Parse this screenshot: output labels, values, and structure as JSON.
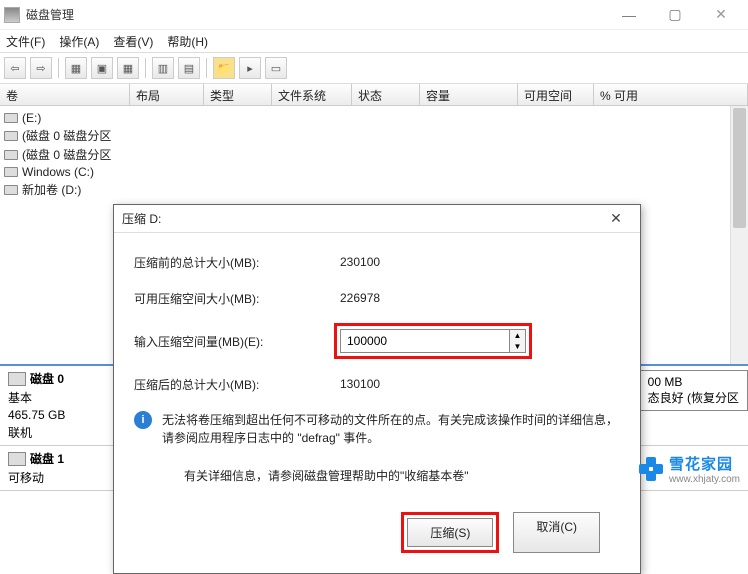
{
  "titlebar": {
    "title": "磁盘管理"
  },
  "menu": {
    "file": "文件(F)",
    "action": "操作(A)",
    "view": "查看(V)",
    "help": "帮助(H)"
  },
  "headers": {
    "volume": "卷",
    "layout": "布局",
    "type": "类型",
    "filesystem": "文件系统",
    "status": "状态",
    "capacity": "容量",
    "free": "可用空间",
    "percent": "% 可用"
  },
  "tree": {
    "items": [
      {
        "label": "(E:)"
      },
      {
        "label": "(磁盘 0 磁盘分区"
      },
      {
        "label": "(磁盘 0 磁盘分区"
      },
      {
        "label": "Windows (C:)"
      },
      {
        "label": "新加卷 (D:)"
      }
    ]
  },
  "disk0": {
    "name": "磁盘 0",
    "type": "基本",
    "size": "465.75 GB",
    "status": "联机",
    "right_size": "00 MB",
    "right_status": "态良好 (恢复分区"
  },
  "disk1": {
    "name": "磁盘 1",
    "type": "可移动"
  },
  "dialog": {
    "title": "压缩 D:",
    "before_label": "压缩前的总计大小(MB):",
    "before_value": "230100",
    "avail_label": "可用压缩空间大小(MB):",
    "avail_value": "226978",
    "input_label": "输入压缩空间量(MB)(E):",
    "input_value": "100000",
    "after_label": "压缩后的总计大小(MB):",
    "after_value": "130100",
    "info_text": "无法将卷压缩到超出任何不可移动的文件所在的点。有关完成该操作时间的详细信息，请参阅应用程序日志中的 \"defrag\" 事件。",
    "hint": "有关详细信息，请参阅磁盘管理帮助中的\"收缩基本卷\"",
    "shrink": "压缩(S)",
    "cancel": "取消(C)"
  },
  "watermark": {
    "main": "雪花家园",
    "sub": "www.xhjaty.com"
  }
}
